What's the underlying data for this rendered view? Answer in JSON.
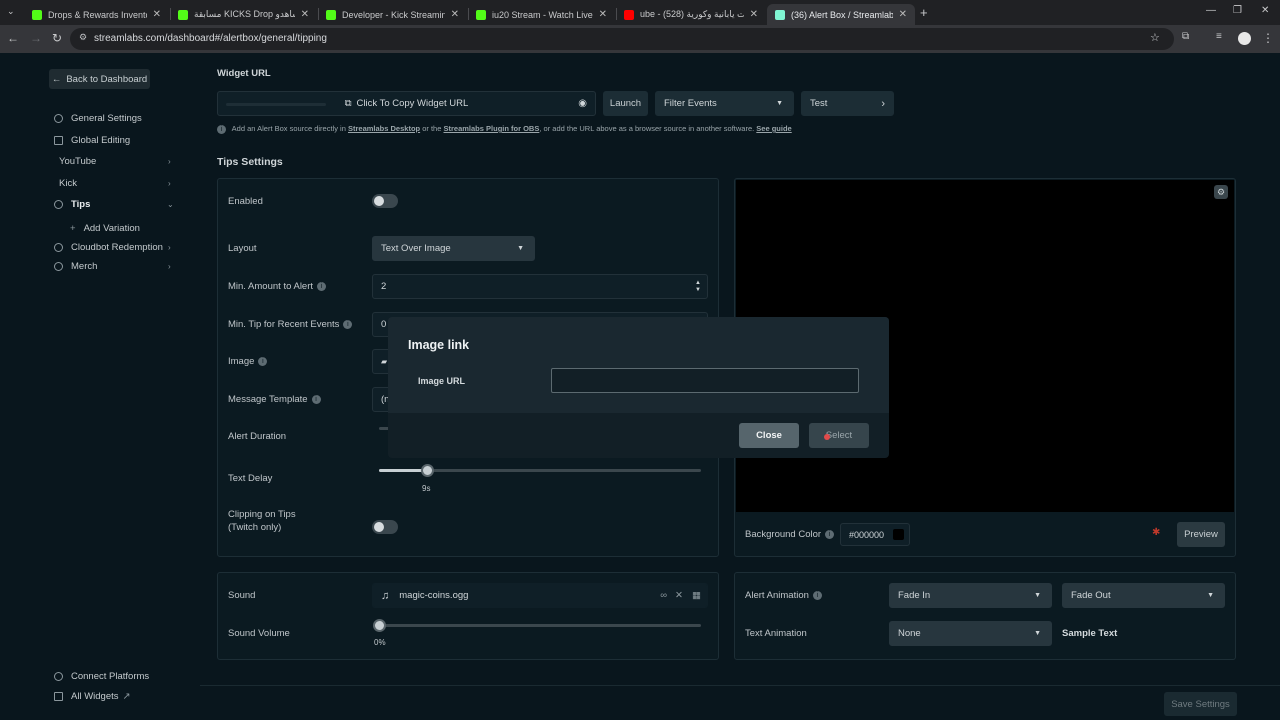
{
  "browser": {
    "tabs": [
      {
        "title": "Drops & Rewards Inventory - K",
        "color": "#53fc18"
      },
      {
        "title": "مسابقة KICKS Drop هذا شاهدو",
        "color": "#53fc18"
      },
      {
        "title": "Developer - Kick Streaming",
        "color": "#53fc18"
      },
      {
        "title": "iu20 Stream - Watch Live on Ki",
        "color": "#53fc18"
      },
      {
        "title": "ube - حلويات يابانية وكورية (528)",
        "color": "#ff0000"
      },
      {
        "title": "(36) Alert Box / Streamlabs",
        "color": "#80f5d2"
      }
    ],
    "url": "streamlabs.com/dashboard#/alertbox/general/tipping"
  },
  "sidebar": {
    "back": "Back to Dashboard",
    "items": [
      {
        "label": "General Settings"
      },
      {
        "label": "Global Editing"
      },
      {
        "label": "YouTube"
      },
      {
        "label": "Kick"
      },
      {
        "label": "Tips"
      },
      {
        "label": "Add Variation"
      },
      {
        "label": "Cloudbot Redemption"
      },
      {
        "label": "Merch"
      }
    ],
    "connect": "Connect Platforms",
    "all_widgets": "All Widgets"
  },
  "widget": {
    "title": "Widget URL",
    "copy": "Click To Copy Widget URL",
    "launch": "Launch",
    "filter": "Filter Events",
    "test": "Test",
    "help_prefix": "Add an Alert Box source directly in",
    "help_link1": "Streamlabs Desktop",
    "help_mid": "or the",
    "help_link2": "Streamlabs Plugin for OBS",
    "help_suffix": ", or add the URL above as a browser source in another software.",
    "help_link3": "See guide"
  },
  "tips": {
    "title": "Tips Settings",
    "enabled": "Enabled",
    "layout": "Layout",
    "layout_value": "Text Over Image",
    "min_amount": "Min. Amount to Alert",
    "min_amount_value": "2",
    "min_recent": "Min. Tip for Recent Events",
    "min_recent_value": "0",
    "image": "Image",
    "message_template": "Message Template",
    "message_value": "(n",
    "alert_duration": "Alert Duration",
    "text_delay": "Text Delay",
    "text_delay_value": "9s",
    "text_delay_fraction": 0.15,
    "clipping_1": "Clipping on Tips",
    "clipping_2": "(Twitch only)"
  },
  "preview": {
    "bg_label": "Background Color",
    "bg_value": "#000000",
    "preview_btn": "Preview"
  },
  "sound": {
    "sound": "Sound",
    "file": "magic-coins.ogg",
    "volume": "Sound Volume",
    "volume_value": "0%",
    "volume_fraction": 0.0
  },
  "animation": {
    "alert": "Alert Animation",
    "fade_in": "Fade In",
    "fade_out": "Fade Out",
    "text": "Text Animation",
    "none": "None",
    "sample": "Sample Text"
  },
  "save": "Save Settings",
  "modal": {
    "title": "Image link",
    "url_label": "Image URL",
    "url_value": "",
    "close": "Close",
    "select": "Select"
  }
}
